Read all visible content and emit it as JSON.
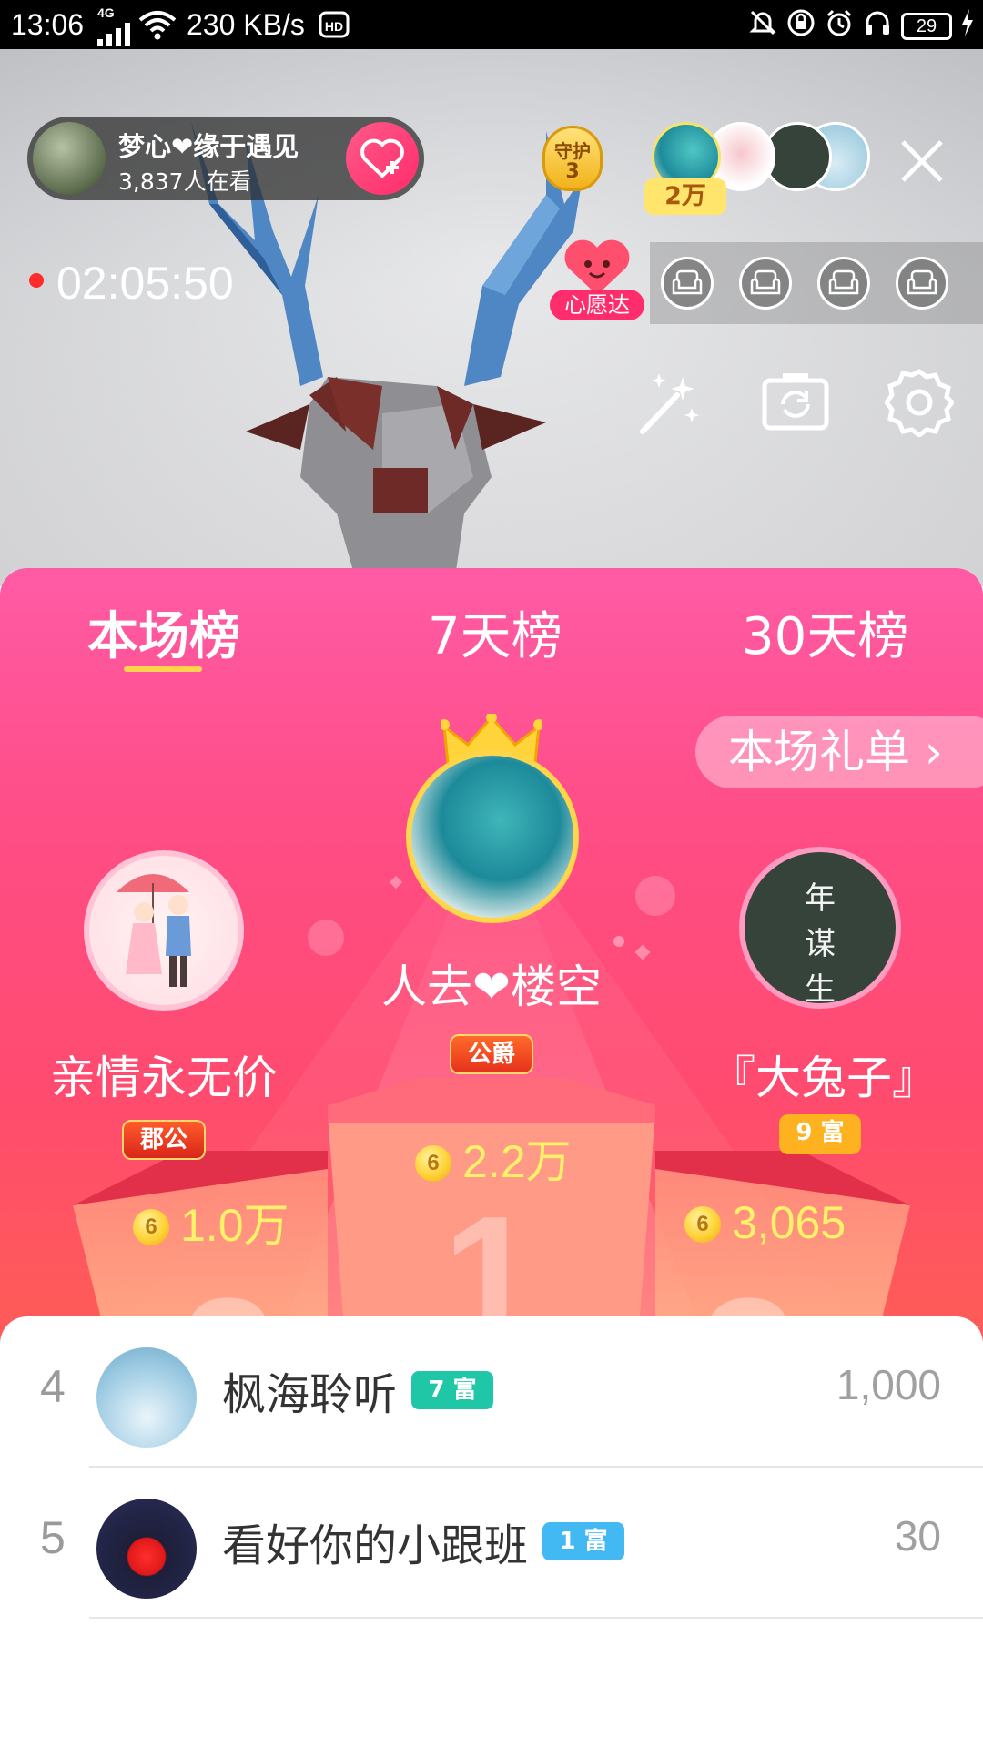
{
  "status_bar": {
    "time": "13:06",
    "network_type": "4G",
    "speed": "230 KB/s",
    "battery": "29",
    "colors": {
      "background": "#000000",
      "text": "#ffffff"
    }
  },
  "live": {
    "host_name": "梦心❤缘于遇见",
    "viewers": "3,837人在看",
    "guard_label": "守护",
    "guard_count": "3",
    "fan_value": "2万",
    "timer": "02:05:50",
    "wish_label": "心愿达",
    "icons": [
      "follow-heart-icon",
      "close-icon",
      "magic-wand-icon",
      "flip-camera-icon",
      "settings-gear-icon",
      "sofa-seat-icon"
    ]
  },
  "ranking": {
    "tabs": [
      "本场榜",
      "7天榜",
      "30天榜"
    ],
    "active_tab": "本场榜",
    "gift_list_button": "本场礼单 ›",
    "top3": [
      {
        "rank": 1,
        "name": "人去❤楼空",
        "badge": "公爵",
        "coins": "2.2万"
      },
      {
        "rank": 2,
        "name": "亲情永无价",
        "badge": "郡公",
        "coins": "1.0万"
      },
      {
        "rank": 3,
        "name": "『大兔子』",
        "badge": "9 富",
        "coins": "3,065"
      }
    ],
    "avatar3_calligraphy": "年\n谋\n生",
    "colors": {
      "panel_top": "#ff5ba5",
      "panel_bottom": "#ff5a5a",
      "coin_text": "#fff26a",
      "tab_indicator": "#ffd34d"
    }
  },
  "list": [
    {
      "rank": "4",
      "name": "枫海聆听",
      "badge": "7 富",
      "badge_color": "#1fc7a7",
      "value": "1,000"
    },
    {
      "rank": "5",
      "name": "看好你的小跟班",
      "badge": "1 富",
      "badge_color": "#42b9f2",
      "value": "30"
    }
  ]
}
